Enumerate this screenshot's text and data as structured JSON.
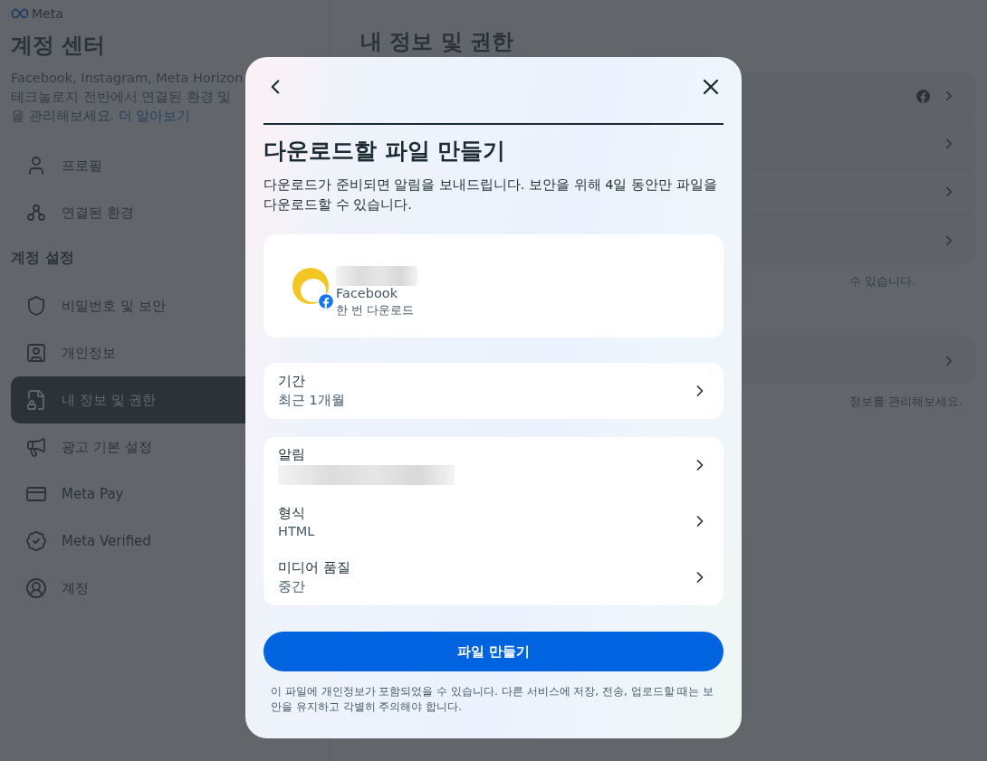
{
  "sidebar": {
    "logo": "Meta",
    "title": "계정 센터",
    "description_lines": [
      "Facebook, Instagram, Meta Horizon",
      "테크놀로지 전반에서 연결된 환경 및",
      "을 관리해보세요."
    ],
    "learn_more": "더 알아보기",
    "sections": [
      {
        "items": [
          {
            "label": "프로필",
            "selected": false
          },
          {
            "label": "연결된 환경",
            "selected": false
          }
        ]
      },
      {
        "heading": "계정 설정",
        "items": [
          {
            "label": "비밀번호 및 보안",
            "selected": false
          },
          {
            "label": "개인정보",
            "selected": false
          },
          {
            "label": "내 정보 및 권한",
            "selected": true
          },
          {
            "label": "광고 기본 설정",
            "selected": false
          },
          {
            "label": "Meta Pay",
            "selected": false
          },
          {
            "label": "Meta Verified",
            "selected": false
          },
          {
            "label": "계정",
            "selected": false
          }
        ]
      }
    ]
  },
  "main": {
    "title": "내 정보 및 권한",
    "cards": [
      {
        "rows": [
          {
            "facebook_badge": true
          },
          {
            "facebook_badge": false
          },
          {
            "facebook_badge": false
          },
          {
            "facebook_badge": false
          }
        ],
        "note": "수 있습니다."
      },
      {
        "rows": [
          {
            "facebook_badge": false
          }
        ],
        "note": "정보를 관리해보세요."
      }
    ]
  },
  "modal": {
    "title": "다운로드할 파일 만들기",
    "description": "다운로드가 준비되면 알림을 보내드립니다. 보안을 위해 4일 동안만 파일을 다운로드할 수 있습니다.",
    "account": {
      "name_redacted": true,
      "platform": "Facebook",
      "mode": "한 번 다운로드"
    },
    "settings_groups": [
      [
        {
          "label": "기간",
          "value": "최근 1개월"
        }
      ],
      [
        {
          "label": "알림",
          "redacted": true
        },
        {
          "label": "형식",
          "value": "HTML"
        },
        {
          "label": "미디어 품질",
          "value": "중간"
        }
      ]
    ],
    "button": "파일 만들기",
    "footer": "이 파일에 개인정보가 포함되었을 수 있습니다. 다른 서비스에 저장, 전송, 업로드할 때는 보안을 유지하고 각별히 주의해야 합니다."
  }
}
